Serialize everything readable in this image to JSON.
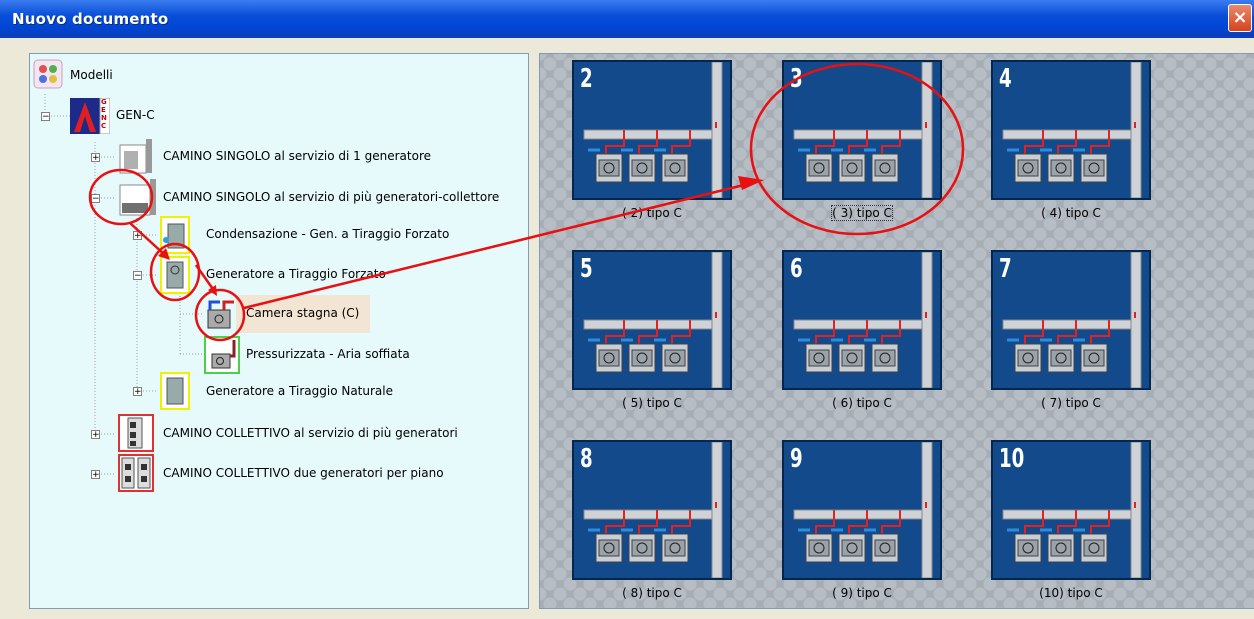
{
  "window": {
    "title": "Nuovo documento",
    "close_label": "×"
  },
  "tree": {
    "root": "Modelli",
    "genc": "GEN-C",
    "genc_logo": "GEN C",
    "items": [
      "CAMINO  SINGOLO al servizio di 1 generatore",
      "CAMINO  SINGOLO al servizio di più generatori-collettore",
      "Condensazione - Gen. a Tiraggio Forzato",
      "Generatore a Tiraggio Forzato",
      "Camera stagna (C)",
      "Pressurizzata - Aria soffiata",
      "Generatore a Tiraggio Naturale",
      "CAMINO COLLETTIVO al servizio di più generatori",
      "CAMINO COLLETTIVO due generatori per piano"
    ],
    "expanders": {
      "plus": "+",
      "minus": "−"
    }
  },
  "gallery": {
    "selected_index": 1,
    "thumbnails": [
      {
        "number": "2",
        "caption": "( 2) tipo C"
      },
      {
        "number": "3",
        "caption": "( 3) tipo C"
      },
      {
        "number": "4",
        "caption": "( 4) tipo C"
      },
      {
        "number": "5",
        "caption": "( 5) tipo C"
      },
      {
        "number": "6",
        "caption": "( 6) tipo C"
      },
      {
        "number": "7",
        "caption": "( 7) tipo C"
      },
      {
        "number": "8",
        "caption": "( 8) tipo C"
      },
      {
        "number": "9",
        "caption": "( 9) tipo C"
      },
      {
        "number": "10",
        "caption": "(10) tipo C"
      }
    ]
  },
  "colors": {
    "annotation": "#e81010",
    "tile": "#124a8c",
    "title_bar": "#0046d5",
    "tree_bg": "#e6f9fb"
  }
}
